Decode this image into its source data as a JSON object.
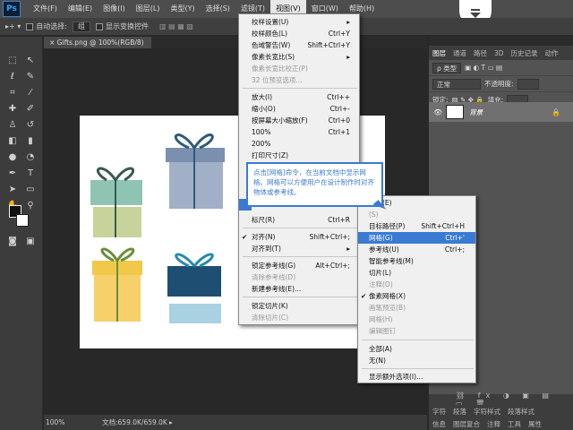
{
  "app": {
    "logo": "Ps"
  },
  "menubar": {
    "items": [
      "文件(F)",
      "编辑(E)",
      "图像(I)",
      "图层(L)",
      "类型(Y)",
      "选择(S)",
      "滤镜(T)",
      "视图(V)",
      "窗口(W)",
      "帮助(H)"
    ]
  },
  "options": {
    "auto_select_label": "自动选择:",
    "auto_select_value": "组",
    "show_transform_label": "显示变换控件"
  },
  "document": {
    "tab_title": "Gifts.png @ 100%(RGB/8)",
    "zoom": "100%",
    "doc_size": "文档:659.0K/659.0K"
  },
  "view_menu": {
    "items": [
      {
        "label": "校样设置(U)",
        "shortcut": "",
        "arrow": "▸",
        "disabled": false
      },
      {
        "label": "校样颜色(L)",
        "shortcut": "Ctrl+Y",
        "disabled": false
      },
      {
        "label": "色域警告(W)",
        "shortcut": "Shift+Ctrl+Y",
        "disabled": false
      },
      {
        "label": "像素长宽比(S)",
        "shortcut": "",
        "arrow": "▸",
        "disabled": false
      },
      {
        "label": "像素长宽比校正(P)",
        "shortcut": "",
        "disabled": true
      },
      {
        "label": "32 位预览选项...",
        "shortcut": "",
        "disabled": true
      },
      {
        "label": "放大(I)",
        "shortcut": "Ctrl++",
        "disabled": false
      },
      {
        "label": "缩小(O)",
        "shortcut": "Ctrl+-",
        "disabled": false
      },
      {
        "label": "按屏幕大小缩放(F)",
        "shortcut": "Ctrl+0",
        "disabled": false
      },
      {
        "label": "100%",
        "shortcut": "Ctrl+1",
        "disabled": false
      },
      {
        "label": "200%",
        "shortcut": "",
        "disabled": false
      },
      {
        "label": "打印尺寸(Z)",
        "shortcut": "",
        "disabled": false
      },
      {
        "label": "标尺(R)",
        "shortcut": "Ctrl+R",
        "disabled": false
      },
      {
        "label": "对齐(N)",
        "shortcut": "Shift+Ctrl+;",
        "check": "✔",
        "disabled": false
      },
      {
        "label": "对齐到(T)",
        "shortcut": "",
        "arrow": "▸",
        "disabled": false
      },
      {
        "label": "锁定参考线(G)",
        "shortcut": "Alt+Ctrl+;",
        "disabled": false
      },
      {
        "label": "清除参考线(D)",
        "shortcut": "",
        "disabled": true
      },
      {
        "label": "新建参考线(E)...",
        "shortcut": "",
        "disabled": false
      },
      {
        "label": "锁定切片(K)",
        "shortcut": "",
        "disabled": false
      },
      {
        "label": "清除切片(C)",
        "shortcut": "",
        "disabled": true
      }
    ]
  },
  "show_submenu": {
    "items": [
      {
        "label": "图像(E)",
        "shortcut": "",
        "disabled": false
      },
      {
        "label": "(S)",
        "shortcut": "",
        "disabled": true
      },
      {
        "label": "目标路径(P)",
        "shortcut": "Shift+Ctrl+H",
        "disabled": false
      },
      {
        "label": "网格(G)",
        "shortcut": "Ctrl+'",
        "disabled": false,
        "highlight": true
      },
      {
        "label": "参考线(U)",
        "shortcut": "Ctrl+;",
        "disabled": false
      },
      {
        "label": "智能参考线(M)",
        "shortcut": "",
        "disabled": false
      },
      {
        "label": "切片(L)",
        "shortcut": "",
        "disabled": false
      },
      {
        "label": "注释(O)",
        "shortcut": "",
        "disabled": true
      },
      {
        "label": "像素网格(X)",
        "shortcut": "",
        "check": "✔",
        "disabled": false
      },
      {
        "label": "画笔预览(B)",
        "shortcut": "",
        "disabled": true
      },
      {
        "label": "网格(H)",
        "shortcut": "",
        "disabled": true
      },
      {
        "label": "编辑图钉",
        "shortcut": "",
        "disabled": true
      },
      {
        "label": "全部(A)",
        "shortcut": "",
        "disabled": false
      },
      {
        "label": "无(N)",
        "shortcut": "",
        "disabled": false
      },
      {
        "label": "显示额外选项(I)...",
        "shortcut": "",
        "disabled": false
      }
    ]
  },
  "callout": {
    "text": "点击[网格]命令，在当前文档中显示网格。网格可以方便用户在设计制作时对齐物体或参考线。"
  },
  "panel": {
    "tabs": [
      "图层",
      "通道",
      "路径",
      "3D",
      "历史记录",
      "动作"
    ],
    "kind_label": "ρ 类型",
    "blend_mode": "正常",
    "opacity_label": "不透明度:",
    "lock_label": "锁定:",
    "fill_label": "填充:",
    "layer_name": "背景",
    "bottom_tabs": [
      "字符",
      "段落",
      "字符样式",
      "段落样式"
    ],
    "bottom_tabs2": [
      "信息",
      "图层复合",
      "注释",
      "工具",
      "属性"
    ]
  },
  "colors": {
    "accent": "#3b7ad2",
    "menubar": "#4d4d4d",
    "panel": "#535353"
  }
}
